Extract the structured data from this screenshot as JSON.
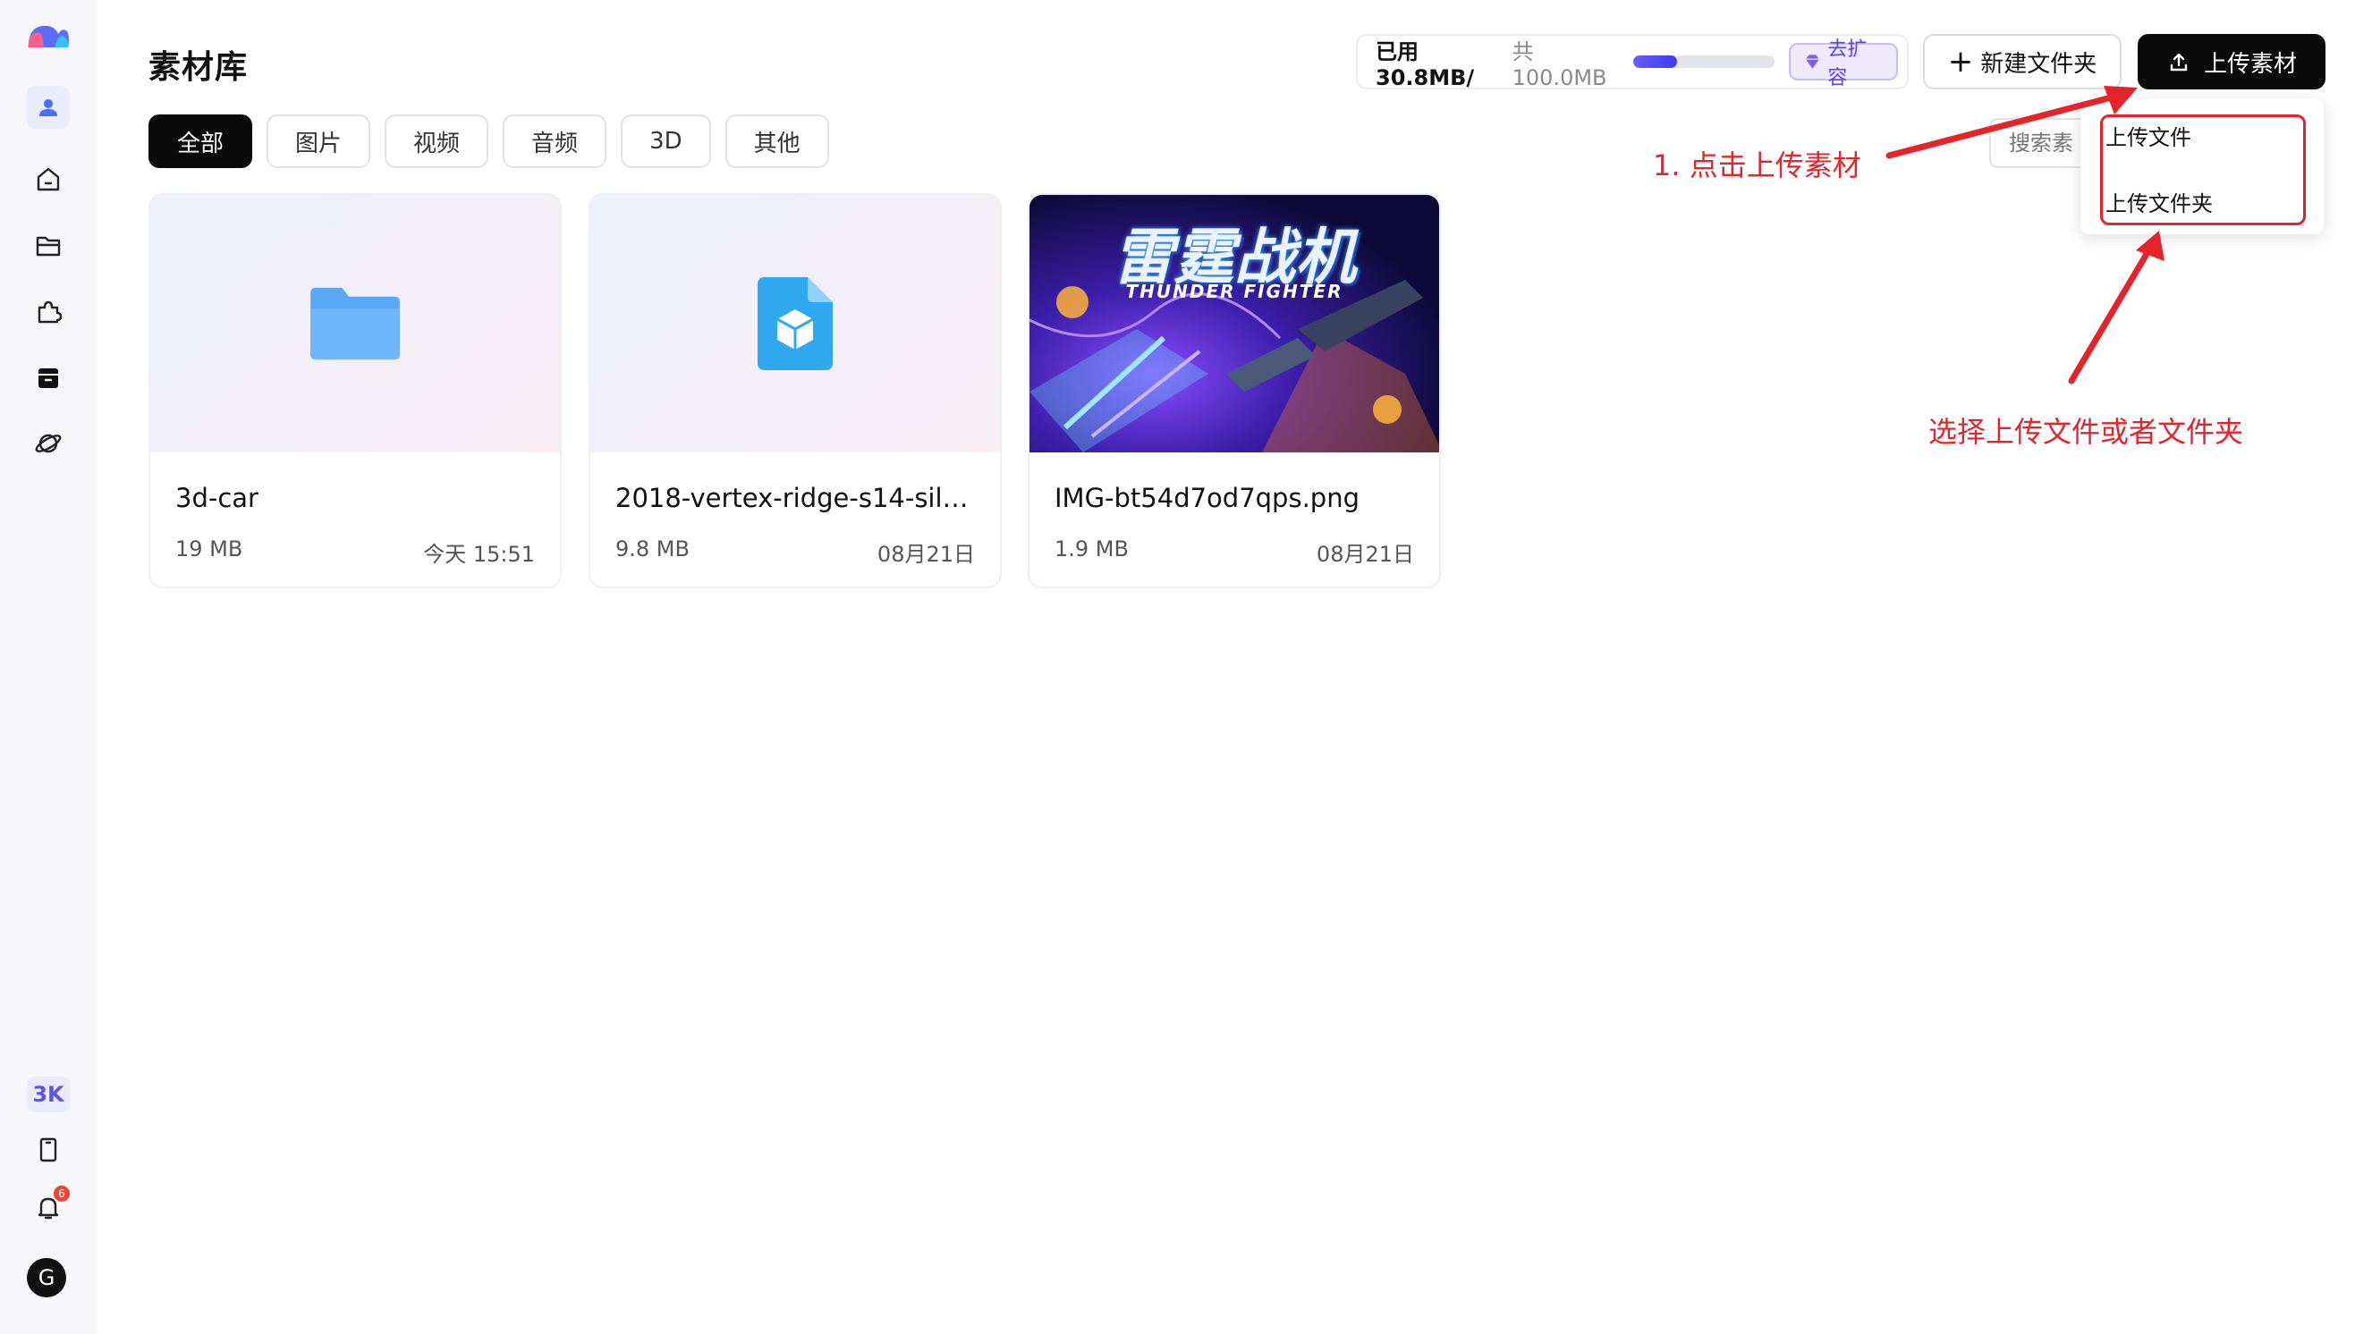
{
  "sidebar": {
    "items": [
      {
        "icon": "user-icon"
      },
      {
        "icon": "home-icon"
      },
      {
        "icon": "folder-icon"
      },
      {
        "icon": "puzzle-icon"
      },
      {
        "icon": "archive-icon"
      },
      {
        "icon": "planet-icon"
      }
    ],
    "badge_label": "3K",
    "notification_count": "6",
    "avatar_initial": "G"
  },
  "header": {
    "title": "素材库",
    "storage": {
      "used_label": "已用30.8MB/",
      "total_label": "共100.0MB",
      "used_fraction": 0.308,
      "expand_label": "去扩容"
    },
    "new_folder_label": "新建文件夹",
    "upload_label": "上传素材"
  },
  "tabs": [
    {
      "label": "全部",
      "active": true
    },
    {
      "label": "图片",
      "active": false
    },
    {
      "label": "视频",
      "active": false
    },
    {
      "label": "音频",
      "active": false
    },
    {
      "label": "3D",
      "active": false
    },
    {
      "label": "其他",
      "active": false
    }
  ],
  "search": {
    "placeholder": "搜索素"
  },
  "dropdown": {
    "items": [
      "上传文件",
      "上传文件夹"
    ]
  },
  "cards": [
    {
      "name": "3d-car",
      "size": "19 MB",
      "date": "今天 15:51",
      "type": "folder"
    },
    {
      "name": "2018-vertex-ridge-s14-silvi...",
      "size": "9.8 MB",
      "date": "08月21日",
      "type": "3d-model"
    },
    {
      "name": "IMG-bt54d7od7qps.png",
      "size": "1.9 MB",
      "date": "08月21日",
      "type": "image",
      "poster_title": "雷霆战机",
      "poster_subtitle": "THUNDER FIGHTER"
    }
  ],
  "annotations": {
    "step1": "1. 点击上传素材",
    "step2": "选择上传文件或者文件夹",
    "color": "#e5232b"
  }
}
